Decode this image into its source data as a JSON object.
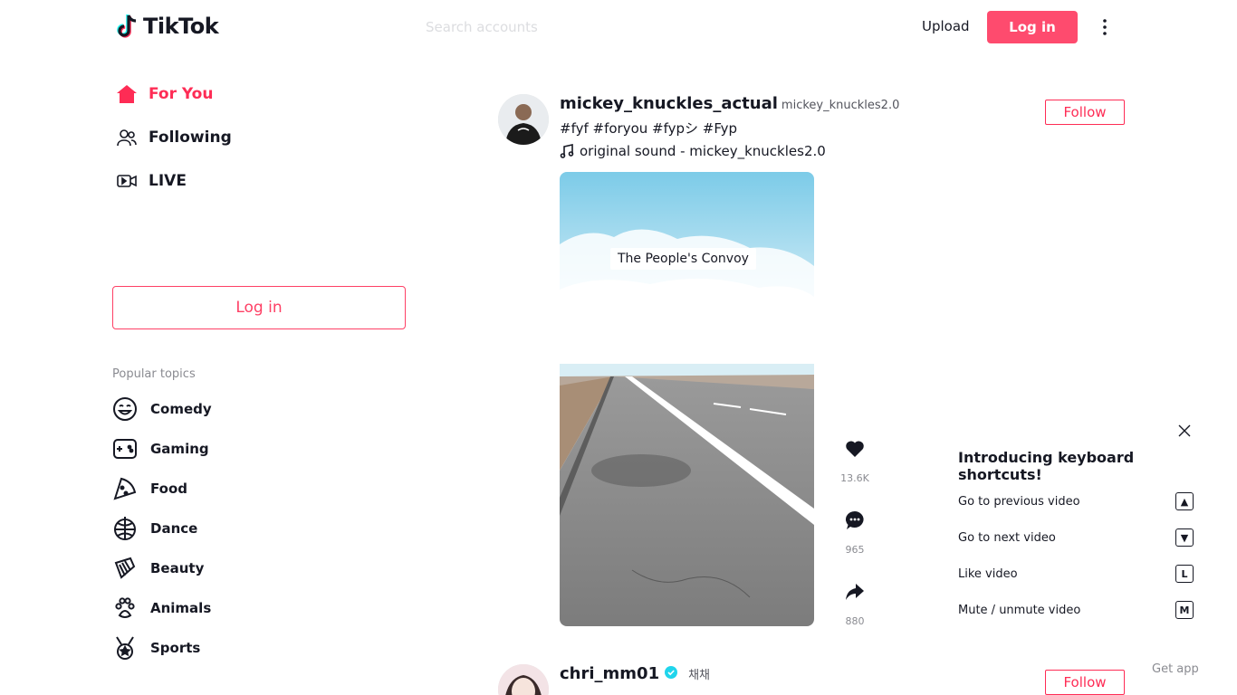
{
  "header": {
    "brand": "TikTok",
    "search_placeholder": "Search accounts",
    "upload": "Upload",
    "login": "Log in",
    "more_icon": "more-vertical-icon"
  },
  "sidebar": {
    "nav": [
      {
        "label": "For You",
        "icon": "home-icon",
        "active": true
      },
      {
        "label": "Following",
        "icon": "people-icon",
        "active": false
      },
      {
        "label": "LIVE",
        "icon": "live-icon",
        "active": false
      }
    ],
    "login": "Log in",
    "topics_title": "Popular topics",
    "topics": [
      {
        "label": "Comedy",
        "icon": "comedy-icon"
      },
      {
        "label": "Gaming",
        "icon": "gaming-icon"
      },
      {
        "label": "Food",
        "icon": "food-icon"
      },
      {
        "label": "Dance",
        "icon": "dance-icon"
      },
      {
        "label": "Beauty",
        "icon": "beauty-icon"
      },
      {
        "label": "Animals",
        "icon": "animals-icon"
      },
      {
        "label": "Sports",
        "icon": "sports-icon"
      }
    ]
  },
  "feed": {
    "posts": [
      {
        "author": "mickey_knuckles_actual",
        "nickname": "mickey_knuckles2.0",
        "description": "#fyf #foryou #fypシ #Fyp",
        "music": "original sound - mickey_knuckles2.0",
        "follow": "Follow",
        "video_caption": "The People's Convoy",
        "likes": "13.6K",
        "comments": "965",
        "shares": "880"
      },
      {
        "author": "chri_mm01",
        "nickname": "채채",
        "verified": true,
        "follow": "Follow"
      }
    ]
  },
  "shortcuts": {
    "title": "Introducing keyboard shortcuts!",
    "items": [
      {
        "label": "Go to previous video",
        "key": "▲"
      },
      {
        "label": "Go to next video",
        "key": "▼"
      },
      {
        "label": "Like video",
        "key": "L"
      },
      {
        "label": "Mute / unmute video",
        "key": "M"
      }
    ]
  },
  "footer": {
    "get_app": "Get app"
  },
  "colors": {
    "accent": "#fe2c55",
    "text": "#161823",
    "muted": "#8a8b91"
  }
}
